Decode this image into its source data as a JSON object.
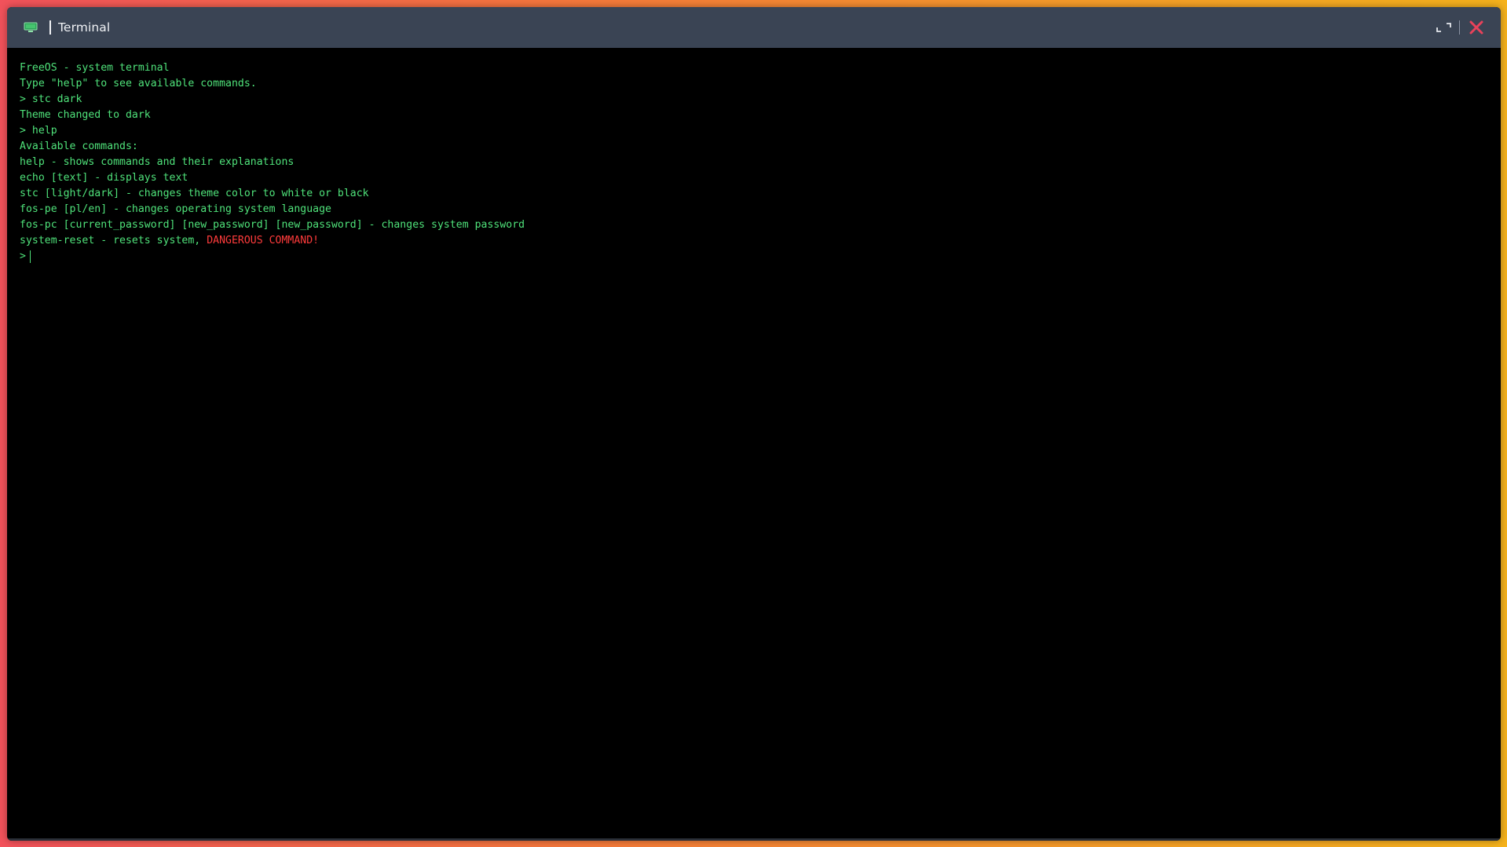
{
  "window": {
    "title": "Terminal",
    "icons": {
      "app": "terminal-monitor-icon",
      "maximize": "maximize-icon",
      "close": "close-icon"
    }
  },
  "colors": {
    "background_gradient_start": "#f2525b",
    "background_gradient_end": "#f5b21c",
    "titlebar": "#3a4454",
    "terminal_background": "#000000",
    "terminal_text": "#4fe27a",
    "danger_text": "#ff3b3b",
    "close_icon": "#e8425a"
  },
  "terminal": {
    "lines": [
      "FreeOS - system terminal",
      "Type \"help\" to see available commands.",
      "> stc dark",
      "Theme changed to dark",
      "> help",
      "Available commands:",
      "help - shows commands and their explanations",
      "echo [text] - displays text",
      "stc [light/dark] - changes theme color to white or black",
      "fos-pe [pl/en] - changes operating system language",
      "fos-pc [current_password] [new_password] [new_password] - changes system password"
    ],
    "reset_line": {
      "text": "system-reset - resets system, ",
      "warning": "DANGEROUS COMMAND!"
    },
    "prompt": ">"
  }
}
